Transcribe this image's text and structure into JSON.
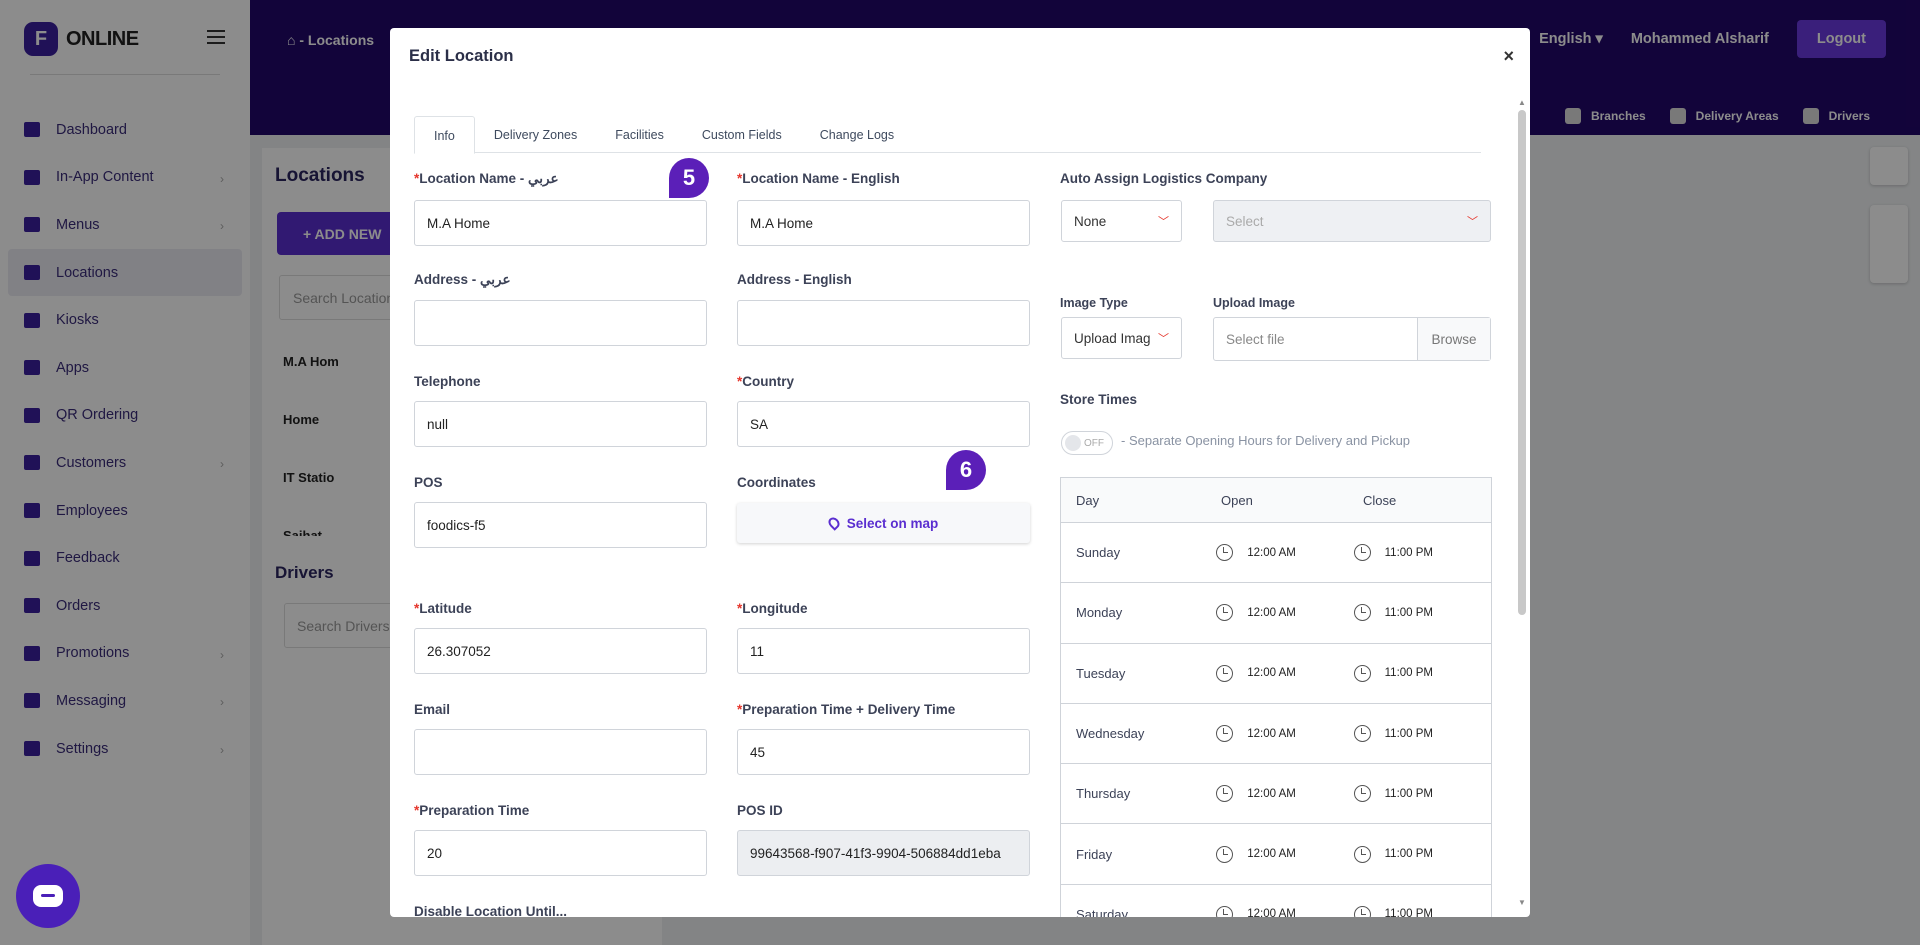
{
  "brand": {
    "name": "ONLINE",
    "mark": "F"
  },
  "sidebar": {
    "items": [
      {
        "label": "Dashboard",
        "icon": "chart-icon",
        "chevron": false
      },
      {
        "label": "In-App Content",
        "icon": "images-icon",
        "chevron": true
      },
      {
        "label": "Menus",
        "icon": "book-icon",
        "chevron": true
      },
      {
        "label": "Locations",
        "icon": "map-pin-icon",
        "chevron": false,
        "active": true
      },
      {
        "label": "Kiosks",
        "icon": "tablet-icon",
        "chevron": false
      },
      {
        "label": "Apps",
        "icon": "phone-icon",
        "chevron": false
      },
      {
        "label": "QR Ordering",
        "icon": "qr-icon",
        "chevron": false
      },
      {
        "label": "Customers",
        "icon": "user-icon",
        "chevron": true
      },
      {
        "label": "Employees",
        "icon": "user-icon",
        "chevron": false
      },
      {
        "label": "Feedback",
        "icon": "comment-icon",
        "chevron": false
      },
      {
        "label": "Orders",
        "icon": "bag-icon",
        "chevron": false
      },
      {
        "label": "Promotions",
        "icon": "percent-icon",
        "chevron": true
      },
      {
        "label": "Messaging",
        "icon": "list-icon",
        "chevron": true
      },
      {
        "label": "Settings",
        "icon": "gear-icon",
        "chevron": true
      }
    ]
  },
  "topbar": {
    "breadcrumb": "-   Locations",
    "language": "English",
    "user": "Mohammed Alsharif",
    "logout": "Logout",
    "filters": [
      "Branches",
      "Delivery Areas",
      "Drivers"
    ]
  },
  "background": {
    "locations_title": "Locations",
    "add_new": "+ ADD NEW",
    "search_locations": "Search Location",
    "locations": [
      "M.A Hom",
      "Home",
      "IT Statio",
      "Saihat"
    ],
    "drivers_title": "Drivers",
    "search_drivers": "Search Drivers"
  },
  "modal": {
    "title": "Edit Location",
    "close": "×",
    "tabs": [
      "Info",
      "Delivery Zones",
      "Facilities",
      "Custom Fields",
      "Change Logs"
    ],
    "fields": {
      "name_ar": {
        "label": "Location Name - عربي",
        "value": "M.A Home",
        "required": true
      },
      "name_en": {
        "label": "Location Name - English",
        "value": "M.A Home",
        "required": true
      },
      "address_ar": {
        "label": "Address - عربي",
        "value": ""
      },
      "address_en": {
        "label": "Address - English",
        "value": ""
      },
      "telephone": {
        "label": "Telephone",
        "value": "null"
      },
      "country": {
        "label": "Country",
        "value": "SA",
        "required": true
      },
      "pos": {
        "label": "POS",
        "value": "foodics-f5"
      },
      "coordinates": {
        "label": "Coordinates",
        "button": "Select on map"
      },
      "latitude": {
        "label": "Latitude",
        "value": "26.307052",
        "required": true
      },
      "longitude": {
        "label": "Longitude",
        "value": "11",
        "required": true
      },
      "email": {
        "label": "Email",
        "value": ""
      },
      "prep_delivery": {
        "label": "Preparation Time + Delivery Time",
        "value": "45",
        "required": true
      },
      "prep_time": {
        "label": "Preparation Time",
        "value": "20",
        "required": true
      },
      "pos_id": {
        "label": "POS ID",
        "value": "99643568-f907-41f3-9904-506884dd1eba"
      },
      "disable_until": {
        "label": "Disable Location Until..."
      }
    },
    "logistics": {
      "label": "Auto Assign Logistics Company",
      "mode": "None",
      "company_placeholder": "Select"
    },
    "image": {
      "type_label": "Image Type",
      "type_value": "Upload Imag",
      "upload_label": "Upload Image",
      "file_placeholder": "Select file",
      "browse": "Browse"
    },
    "store_times": {
      "label": "Store Times",
      "toggle": "OFF",
      "toggle_note": "- Separate Opening Hours for Delivery and Pickup",
      "headers": {
        "day": "Day",
        "open": "Open",
        "close": "Close"
      },
      "rows": [
        {
          "day": "Sunday",
          "open": "12:00 AM",
          "close": "11:00 PM"
        },
        {
          "day": "Monday",
          "open": "12:00 AM",
          "close": "11:00 PM"
        },
        {
          "day": "Tuesday",
          "open": "12:00 AM",
          "close": "11:00 PM"
        },
        {
          "day": "Wednesday",
          "open": "12:00 AM",
          "close": "11:00 PM"
        },
        {
          "day": "Thursday",
          "open": "12:00 AM",
          "close": "11:00 PM"
        },
        {
          "day": "Friday",
          "open": "12:00 AM",
          "close": "11:00 PM"
        },
        {
          "day": "Saturday",
          "open": "12:00 AM",
          "close": "11:00 PM"
        }
      ]
    }
  },
  "badges": {
    "step5": "5",
    "step6": "6"
  },
  "colors": {
    "brand": "#22086a",
    "accent": "#5a2ed0",
    "required": "#e5352b"
  }
}
